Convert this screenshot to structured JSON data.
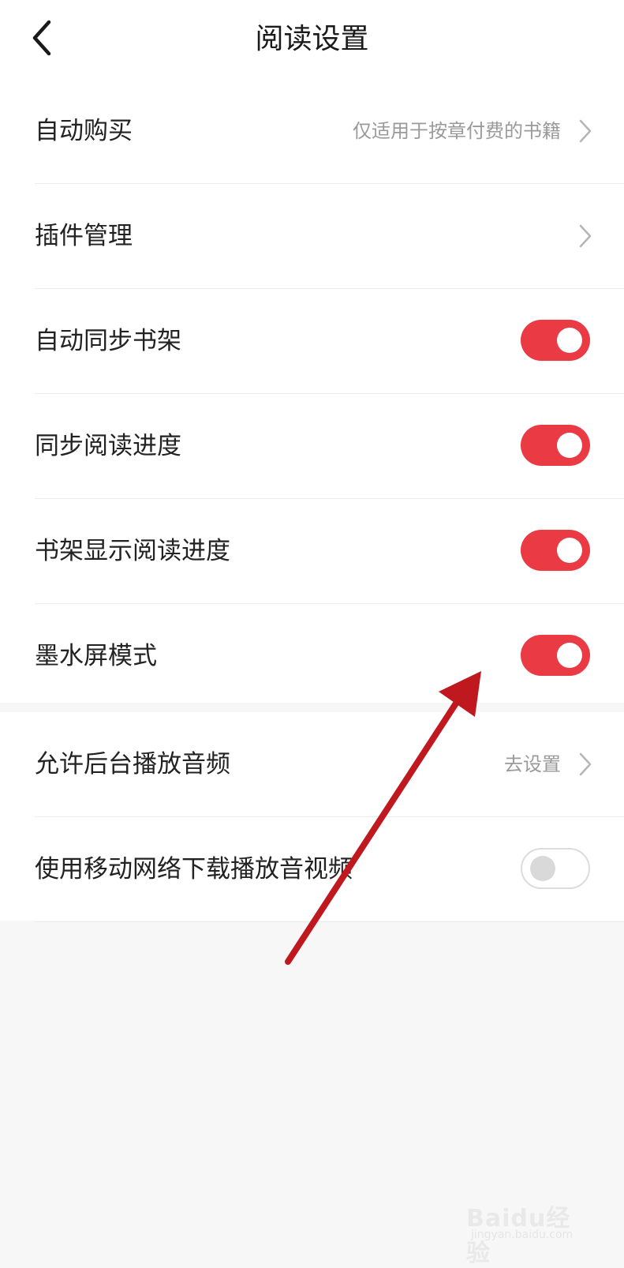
{
  "header": {
    "title": "阅读设置",
    "back_icon": "back-icon"
  },
  "settings": {
    "auto_purchase": {
      "label": "自动购买",
      "hint": "仅适用于按章付费的书籍"
    },
    "plugin_manage": {
      "label": "插件管理"
    },
    "auto_sync_shelf": {
      "label": "自动同步书架",
      "enabled": true
    },
    "sync_progress": {
      "label": "同步阅读进度",
      "enabled": true
    },
    "shelf_show_progress": {
      "label": "书架显示阅读进度",
      "enabled": true
    },
    "eink_mode": {
      "label": "墨水屏模式",
      "enabled": true
    },
    "bg_audio": {
      "label": "允许后台播放音频",
      "hint": "去设置"
    },
    "mobile_download": {
      "label": "使用移动网络下载播放音视频",
      "enabled": false
    }
  },
  "colors": {
    "toggle_on": "#ea3b44",
    "annotation_arrow": "#c0181f"
  },
  "watermark": {
    "brand": "Baidu经验",
    "domain": "jingyan.baidu.com"
  }
}
